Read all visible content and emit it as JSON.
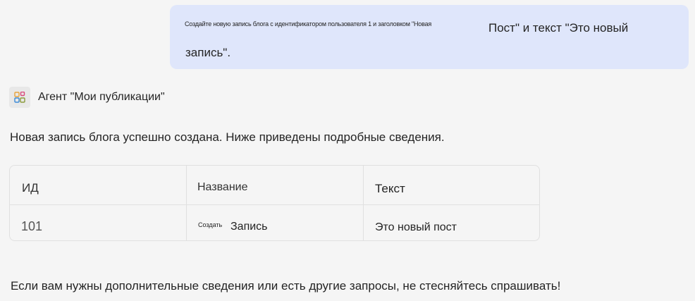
{
  "user_message": {
    "small_text": "Создайте новую запись блога с идентификатором пользователя 1 и заголовком \"Новая",
    "large_text": "Пост\" и текст \"Это новый",
    "line2": "запись\"."
  },
  "agent": {
    "name": "Агент \"Мои публикации\"",
    "icon": "apps-icon"
  },
  "intro": "Новая запись блога успешно создана. Ниже приведены подробные сведения.",
  "table": {
    "headers": [
      "ИД",
      "Название",
      "Текст"
    ],
    "row": {
      "id": "101",
      "name_small": "Создать",
      "name_large": "Запись",
      "text": "Это новый пост"
    }
  },
  "closing": "Если вам нужны дополнительные сведения или есть другие запросы, не стесняйтесь спрашивать!"
}
